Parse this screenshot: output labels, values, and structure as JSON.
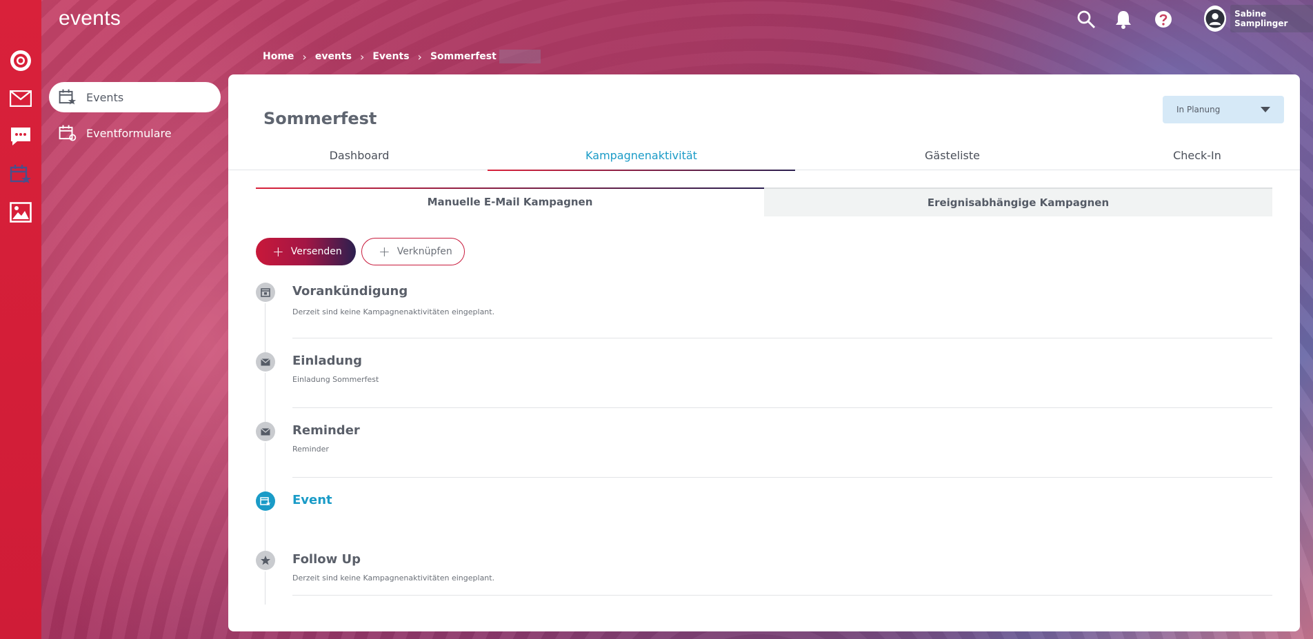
{
  "app": {
    "title": "events"
  },
  "header": {
    "user_name": "Sabine Samplinger"
  },
  "rail": [
    {
      "name": "logo-icon"
    },
    {
      "name": "mail-icon"
    },
    {
      "name": "chat-icon"
    },
    {
      "name": "events-calendar-icon"
    },
    {
      "name": "image-icon"
    }
  ],
  "sidebar": {
    "items": [
      {
        "label": "Events",
        "active": true
      },
      {
        "label": "Eventformulare",
        "active": false
      }
    ]
  },
  "breadcrumb": [
    "Home",
    "events",
    "Events",
    "Sommerfest"
  ],
  "page": {
    "title": "Sommerfest",
    "status": "In Planung"
  },
  "tabs": [
    {
      "label": "Dashboard",
      "active": false
    },
    {
      "label": "Kampagnenaktivität",
      "active": true
    },
    {
      "label": "Gästeliste",
      "active": false
    },
    {
      "label": "Check-In",
      "active": false
    }
  ],
  "subtabs": [
    {
      "label": "Manuelle E-Mail Kampagnen",
      "active": true
    },
    {
      "label": "Ereignisabhängige Kampagnen",
      "active": false
    }
  ],
  "actions": {
    "send_label": "Versenden",
    "link_label": "Verknüpfen"
  },
  "timeline": [
    {
      "title": "Vorankündigung",
      "desc": "Derzeit sind keine Kampagnenaktivitäten eingeplant.",
      "icon": "calendar-icon",
      "active": false
    },
    {
      "title": "Einladung",
      "desc": "Einladung Sommerfest",
      "icon": "mail-icon",
      "active": false
    },
    {
      "title": "Reminder",
      "desc": "Reminder",
      "icon": "mail-icon",
      "active": false
    },
    {
      "title": "Event",
      "desc": "",
      "icon": "event-calendar-icon",
      "active": true
    },
    {
      "title": "Follow Up",
      "desc": "Derzeit sind keine Kampagnenaktivitäten eingeplant.",
      "icon": "star-icon",
      "active": false
    }
  ],
  "colors": {
    "primary_red": "#d9213a",
    "accent_blue": "#1a9bc7",
    "status_bg": "#d6e9f7"
  }
}
